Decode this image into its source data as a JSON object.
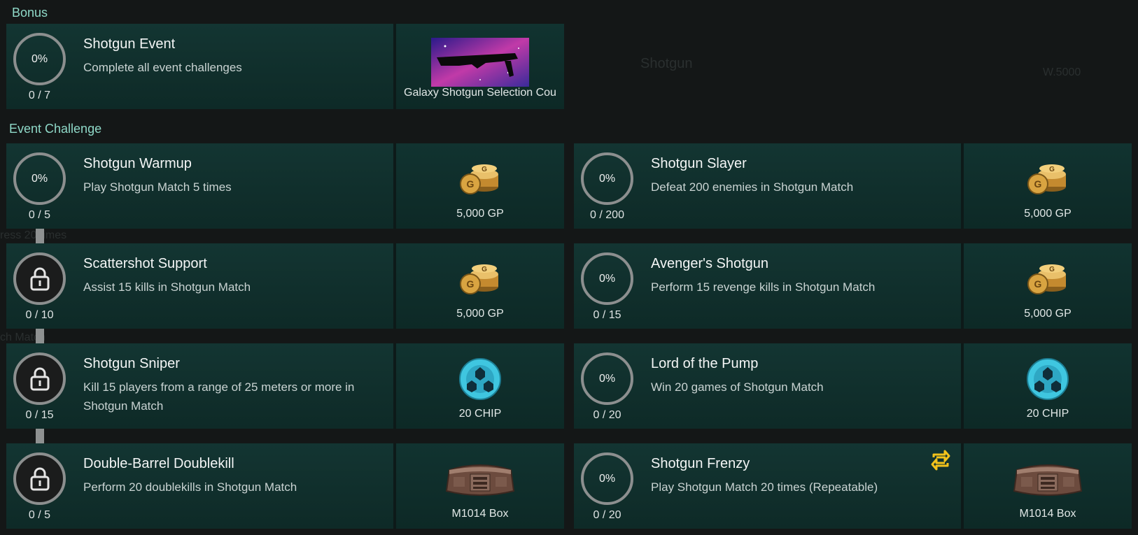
{
  "sections": {
    "bonus": "Bonus",
    "event_challenge": "Event Challenge"
  },
  "background_texts": [
    "Shotgun",
    "W.5000",
    "ress 20 times",
    "ch Match"
  ],
  "bonus": {
    "progress": "0%",
    "count": "0 / 7",
    "title": "Shotgun Event",
    "desc": "Complete all event challenges",
    "reward": "Galaxy Shotgun Selection Cou"
  },
  "challenges": [
    {
      "progress": "0%",
      "count": "0 / 5",
      "title": "Shotgun Warmup",
      "desc": "Play Shotgun Match 5 times",
      "reward": "5,000 GP",
      "icon": "gp-coins-icon",
      "locked": false
    },
    {
      "progress": "0%",
      "count": "0 / 200",
      "title": "Shotgun Slayer",
      "desc": "Defeat 200 enemies in Shotgun Match",
      "reward": "5,000 GP",
      "icon": "gp-coins-icon",
      "locked": false
    },
    {
      "progress": "",
      "count": "0 / 10",
      "title": "Scattershot Support",
      "desc": "Assist 15 kills in Shotgun Match",
      "reward": "5,000 GP",
      "icon": "gp-coins-icon",
      "locked": true
    },
    {
      "progress": "0%",
      "count": "0 / 15",
      "title": "Avenger's Shotgun",
      "desc": "Perform 15 revenge kills in Shotgun Match",
      "reward": "5,000 GP",
      "icon": "gp-coins-icon",
      "locked": false
    },
    {
      "progress": "",
      "count": "0 / 15",
      "title": "Shotgun Sniper",
      "desc": "Kill 15 players from a range of 25 meters or more in Shotgun Match",
      "reward": "20 CHIP",
      "icon": "chip-icon",
      "locked": true
    },
    {
      "progress": "0%",
      "count": "0 / 20",
      "title": "Lord of the Pump",
      "desc": "Win 20 games of Shotgun Match",
      "reward": "20 CHIP",
      "icon": "chip-icon",
      "locked": false
    },
    {
      "progress": "",
      "count": "0 / 5",
      "title": "Double-Barrel Doublekill",
      "desc": "Perform 20 doublekills in Shotgun Match",
      "reward": "M1014 Box",
      "icon": "m1014-box-icon",
      "locked": true
    },
    {
      "progress": "0%",
      "count": "0 / 20",
      "title": "Shotgun Frenzy",
      "desc": "Play Shotgun Match 20 times (Repeatable)",
      "reward": "M1014 Box",
      "icon": "m1014-box-icon",
      "locked": false,
      "repeatable": true
    }
  ],
  "colors": {
    "accent": "#8fd9c8",
    "card": "#133532",
    "repeat": "#f2c21b",
    "chip": "#3fc6e0",
    "coin": "#d9a441"
  }
}
